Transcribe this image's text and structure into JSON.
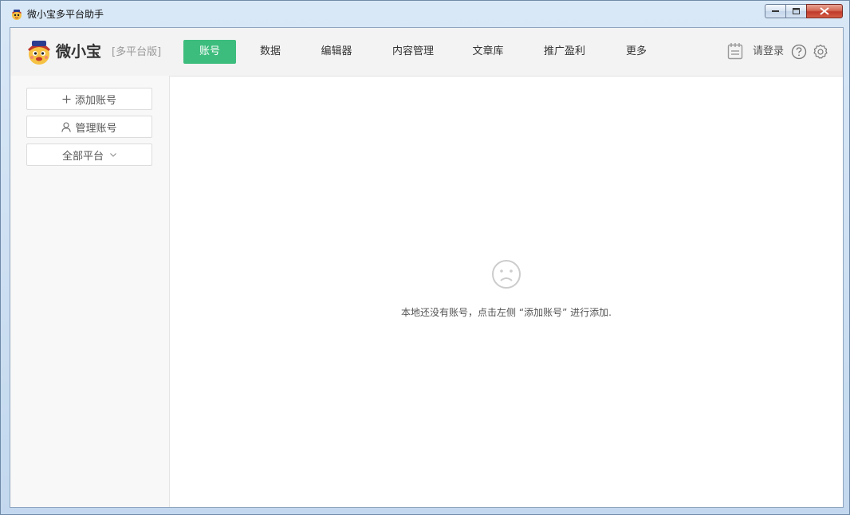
{
  "window": {
    "title": "微小宝多平台助手"
  },
  "app": {
    "logo_name": "微小宝",
    "logo_version": "[多平台版]"
  },
  "nav": {
    "items": [
      {
        "label": "账号",
        "active": true
      },
      {
        "label": "数据"
      },
      {
        "label": "编辑器"
      },
      {
        "label": "内容管理"
      },
      {
        "label": "文章库"
      },
      {
        "label": "推广盈利"
      },
      {
        "label": "更多"
      }
    ]
  },
  "header_right": {
    "login_label": "请登录",
    "icons": [
      "notepad-icon",
      "help-icon",
      "settings-icon"
    ]
  },
  "sidebar": {
    "add_account": "添加账号",
    "manage_account": "管理账号",
    "platform_filter": "全部平台"
  },
  "main": {
    "empty_message": "本地还没有账号，点击左侧 “添加账号” 进行添加."
  },
  "colors": {
    "accent": "#3dbd7d",
    "close_button": "#c0392b"
  }
}
